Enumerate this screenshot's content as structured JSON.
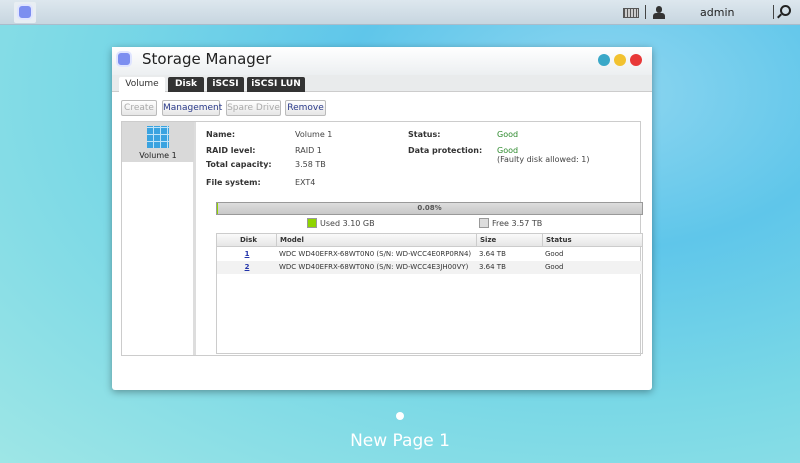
{
  "topbar": {
    "user": "admin"
  },
  "window": {
    "title": "Storage Manager",
    "tabs": [
      "Volume",
      "Disk",
      "iSCSI",
      "iSCSI LUN"
    ],
    "buttons": {
      "create": "Create",
      "management": "Management",
      "spare": "Spare Drive",
      "remove": "Remove"
    },
    "volumes": [
      {
        "label": "Volume 1"
      }
    ],
    "info": {
      "name_label": "Name:",
      "name": "Volume 1",
      "raid_label": "RAID level:",
      "raid": "RAID 1",
      "cap_label": "Total capacity:",
      "cap": "3.58 TB",
      "fs_label": "File system:",
      "fs": "EXT4",
      "status_label": "Status:",
      "status": "Good",
      "prot_label": "Data protection:",
      "prot": "Good",
      "prot_note": "(Faulty disk allowed: 1)"
    },
    "usage": {
      "percent_text": "0.08%",
      "percent": 0.08,
      "used": "Used 3.10 GB",
      "free": "Free 3.57 TB"
    },
    "table": {
      "headers": [
        "Disk",
        "Model",
        "Size",
        "Status"
      ],
      "rows": [
        [
          "1",
          "WDC WD40EFRX-68WT0N0 (S/N: WD-WCC4E0RP0RN4)",
          "3.64 TB",
          "Good"
        ],
        [
          "2",
          "WDC WD40EFRX-68WT0N0 (S/N: WD-WCC4E3JH00VY)",
          "3.64 TB",
          "Good"
        ]
      ]
    }
  },
  "desktop": {
    "page": "New Page 1"
  },
  "colors": {
    "good": "#2d8a2d",
    "used": "#8fd400"
  }
}
